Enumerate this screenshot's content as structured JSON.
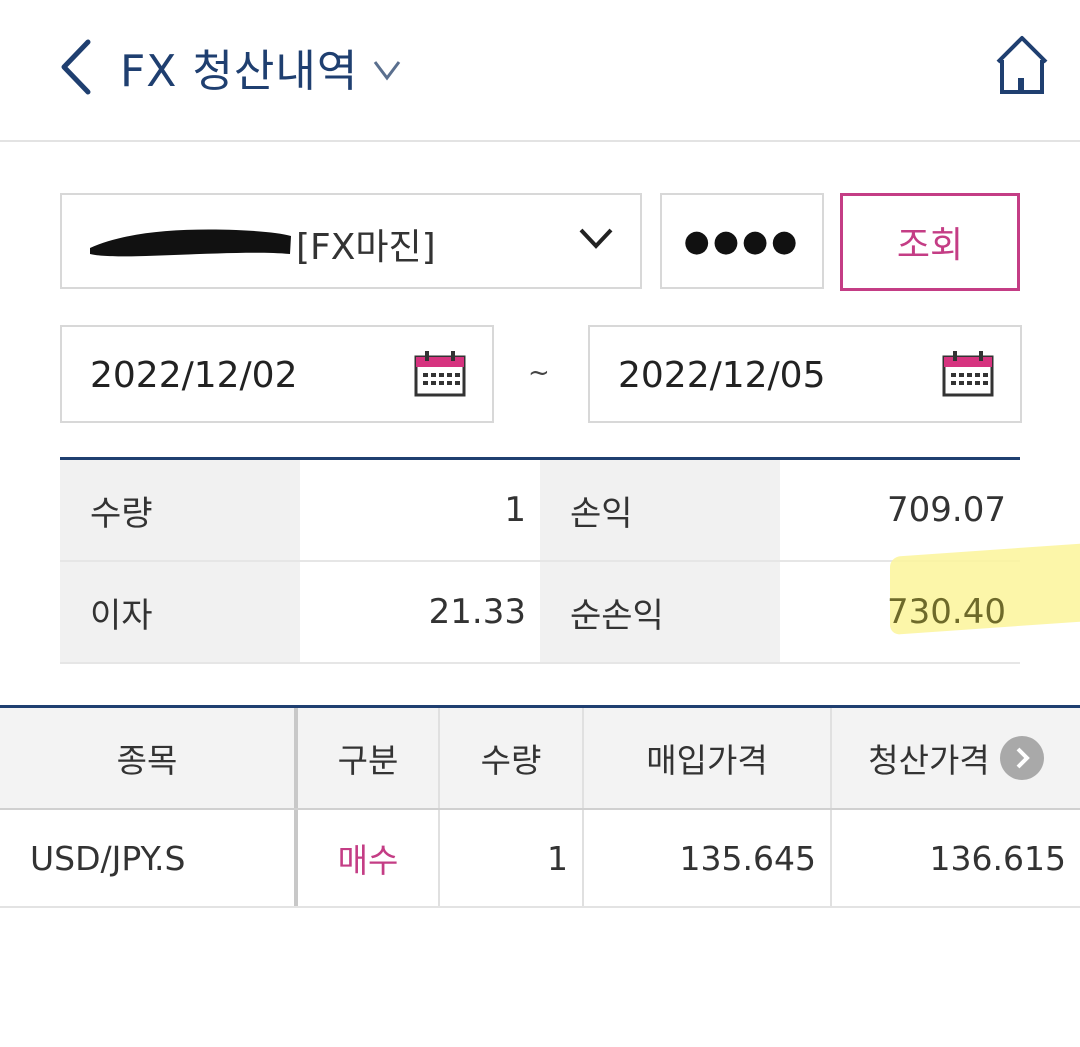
{
  "header": {
    "title": "FX 청산내역",
    "back_icon": "chevron-left-icon",
    "home_icon": "home-icon",
    "title_dropdown_icon": "chevron-down-icon"
  },
  "search": {
    "account_label": "[FX마진]",
    "password_masked": "●●●●",
    "search_button": "조회",
    "date_from": "2022/12/02",
    "date_separator": "~",
    "date_to": "2022/12/05"
  },
  "summary": {
    "rows": [
      {
        "label_a": "수량",
        "value_a": "1",
        "label_b": "손익",
        "value_b": "709.07"
      },
      {
        "label_a": "이자",
        "value_a": "21.33",
        "label_b": "순손익",
        "value_b": "730.40"
      }
    ]
  },
  "detail": {
    "columns": [
      "종목",
      "구분",
      "수량",
      "매입가격",
      "청산가격"
    ],
    "rows": [
      [
        "USD/JPY.S",
        "매수",
        "1",
        "135.645",
        "136.615"
      ]
    ]
  },
  "colors": {
    "navy": "#1f3f70",
    "accent_pink": "#c43d85",
    "highlight_yellow": "#fbf59a"
  }
}
